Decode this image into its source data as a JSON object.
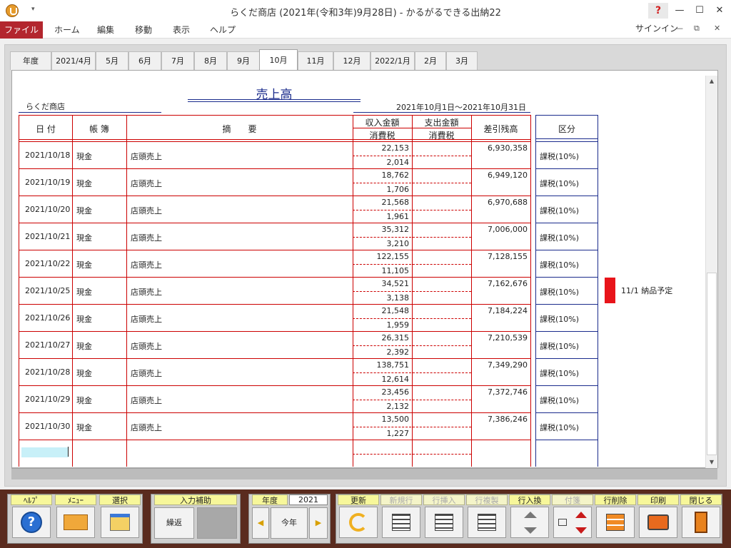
{
  "window": {
    "title": "らくだ商店 (2021年(令和3年)9月28日) - かるがるできる出納22",
    "help": "?",
    "minimize": "—",
    "maximize": "☐",
    "close": "✕",
    "qat_arrow": "▾"
  },
  "menu": {
    "file": "ファイル",
    "items": [
      "ホーム",
      "編集",
      "移動",
      "表示",
      "ヘルプ"
    ],
    "signin": "サインイン",
    "ribbon_min": "—",
    "ribbon_restore": "⧉",
    "ribbon_close": "✕"
  },
  "tabs": [
    "年度",
    "2021/4月",
    "5月",
    "6月",
    "7月",
    "8月",
    "9月",
    "10月",
    "11月",
    "12月",
    "2022/1月",
    "2月",
    "3月"
  ],
  "active_tab": 7,
  "report": {
    "title": "売上高",
    "shop": "らくだ商店",
    "period": "2021年10月1日～2021年10月31日"
  },
  "headers": {
    "date": "日 付",
    "book": "帳 簿",
    "desc": "摘　　要",
    "income": "収入金額",
    "income_tax": "消費税",
    "expense": "支出金額",
    "expense_tax": "消費税",
    "balance": "差引残高",
    "category": "区分"
  },
  "rows": [
    {
      "date": "2021/10/18",
      "book": "現金",
      "desc": "店頭売上",
      "income": "22,153",
      "tax": "2,014",
      "balance": "6,930,358",
      "category": "課税(10%)"
    },
    {
      "date": "2021/10/19",
      "book": "現金",
      "desc": "店頭売上",
      "income": "18,762",
      "tax": "1,706",
      "balance": "6,949,120",
      "category": "課税(10%)"
    },
    {
      "date": "2021/10/20",
      "book": "現金",
      "desc": "店頭売上",
      "income": "21,568",
      "tax": "1,961",
      "balance": "6,970,688",
      "category": "課税(10%)"
    },
    {
      "date": "2021/10/21",
      "book": "現金",
      "desc": "店頭売上",
      "income": "35,312",
      "tax": "3,210",
      "balance": "7,006,000",
      "category": "課税(10%)"
    },
    {
      "date": "2021/10/22",
      "book": "現金",
      "desc": "店頭売上",
      "income": "122,155",
      "tax": "11,105",
      "balance": "7,128,155",
      "category": "課税(10%)"
    },
    {
      "date": "2021/10/25",
      "book": "現金",
      "desc": "店頭売上",
      "income": "34,521",
      "tax": "3,138",
      "balance": "7,162,676",
      "category": "課税(10%)"
    },
    {
      "date": "2021/10/26",
      "book": "現金",
      "desc": "店頭売上",
      "income": "21,548",
      "tax": "1,959",
      "balance": "7,184,224",
      "category": "課税(10%)"
    },
    {
      "date": "2021/10/27",
      "book": "現金",
      "desc": "店頭売上",
      "income": "26,315",
      "tax": "2,392",
      "balance": "7,210,539",
      "category": "課税(10%)"
    },
    {
      "date": "2021/10/28",
      "book": "現金",
      "desc": "店頭売上",
      "income": "138,751",
      "tax": "12,614",
      "balance": "7,349,290",
      "category": "課税(10%)"
    },
    {
      "date": "2021/10/29",
      "book": "現金",
      "desc": "店頭売上",
      "income": "23,456",
      "tax": "2,132",
      "balance": "7,372,746",
      "category": "課税(10%)"
    },
    {
      "date": "2021/10/30",
      "book": "現金",
      "desc": "店頭売上",
      "income": "13,500",
      "tax": "1,227",
      "balance": "7,386,246",
      "category": "課税(10%)"
    }
  ],
  "note": {
    "text": "11/1 納品予定",
    "color": "#e8141a"
  },
  "toolbar": {
    "help": "ﾍﾙﾌﾟ",
    "menu": "ﾒﾆｭｰ",
    "select": "選択",
    "input_assist": "入力補助",
    "repeat": "繰返",
    "year_label": "年度",
    "year_value": "2021",
    "this_year": "今年",
    "prev": "◀",
    "next": "▶",
    "refresh": "更新",
    "new_row": "新規行",
    "insert_row": "行挿入",
    "copy_row": "行複製",
    "swap_row": "行入換",
    "sticky": "付箋",
    "delete_row": "行削除",
    "print": "印刷",
    "close": "閉じる"
  },
  "colors": {
    "accent": "#b3262e",
    "table_border": "#cc0000",
    "header_blue": "#1a2b8c",
    "toolbar_bg": "#5a2b1e",
    "label_yellow": "#f7f79a"
  }
}
